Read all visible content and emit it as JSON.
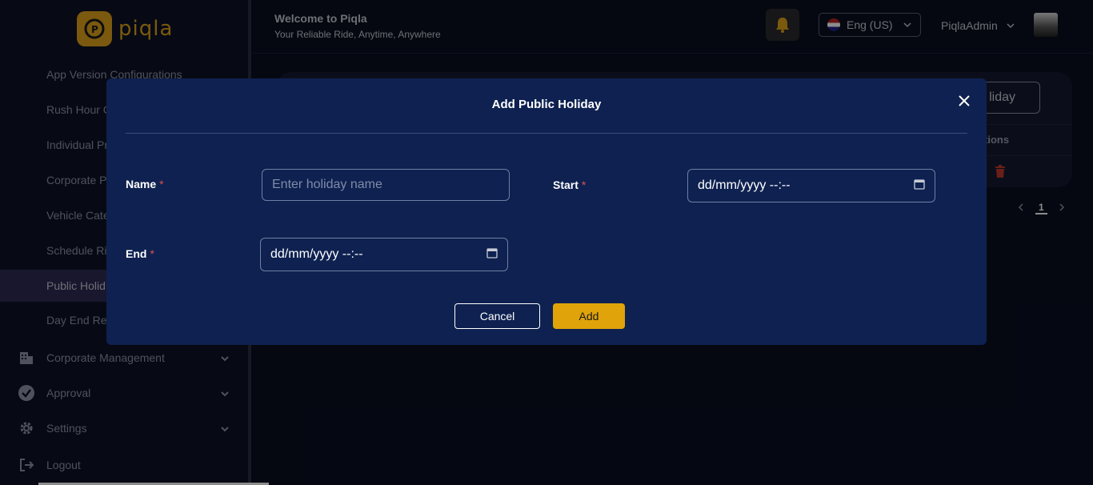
{
  "sidebar": {
    "logo_text": "piqla",
    "sub_items": [
      {
        "label": "App Version Configurations"
      },
      {
        "label": "Rush Hour C"
      },
      {
        "label": "Individual Pr"
      },
      {
        "label": "Corporate P"
      },
      {
        "label": "Vehicle Cate"
      },
      {
        "label": "Schedule Rid"
      },
      {
        "label": "Public Holid"
      },
      {
        "label": "Day End Rep"
      }
    ],
    "groups": [
      {
        "label": "Corporate Management",
        "icon": "building-icon"
      },
      {
        "label": "Approval",
        "icon": "verified-badge-icon"
      },
      {
        "label": "Settings",
        "icon": "gear-icon"
      },
      {
        "label": "Logout",
        "icon": "logout-icon"
      }
    ]
  },
  "header": {
    "title": "Welcome to Piqla",
    "subtitle": "Your Reliable Ride, Anytime, Anywhere",
    "language": "Eng (US)",
    "username": "PiqlaAdmin"
  },
  "background": {
    "button_label": "liday",
    "column_header": "tions",
    "current_page": "1"
  },
  "modal": {
    "title": "Add Public Holiday",
    "name_label": "Name",
    "name_placeholder": "Enter holiday name",
    "start_label": "Start",
    "start_value": "dd/mm/yyyy  --:--",
    "end_label": "End",
    "end_value": "dd/mm/yyyy  --:--",
    "required_mark": "*",
    "cancel_label": "Cancel",
    "add_label": "Add"
  },
  "colors": {
    "accent": "#e0a40a",
    "modal_bg": "#0e2150",
    "active_item": "#2f2a55"
  }
}
